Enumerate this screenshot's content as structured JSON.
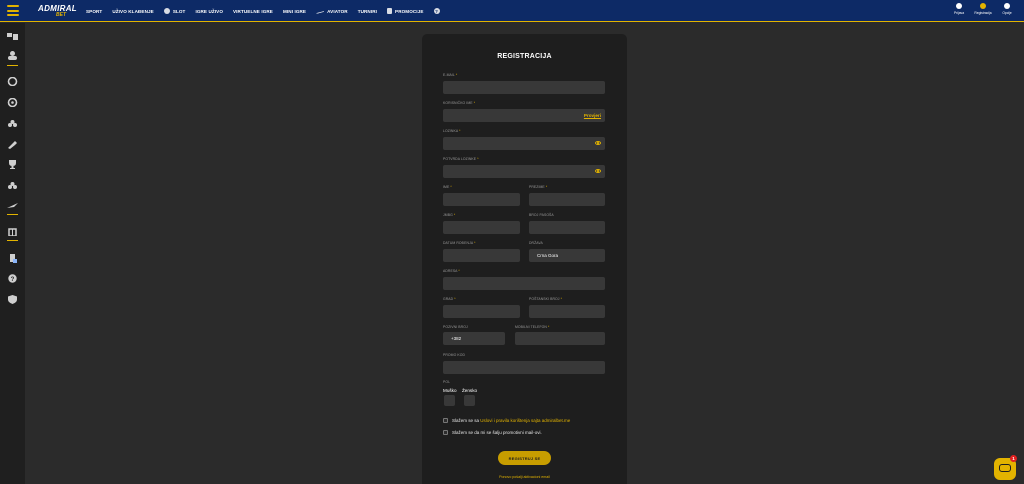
{
  "header": {
    "logo_text": "ADMIRAL",
    "logo_sub": "BET",
    "nav": [
      {
        "label": "SPORT",
        "icon": "none"
      },
      {
        "label": "UŽIVO KLAĐENJE",
        "icon": "none"
      },
      {
        "label": "SLOT",
        "icon": "chip-icon"
      },
      {
        "label": "IGRE UŽIVO",
        "icon": "none"
      },
      {
        "label": "VIRTUELNE IGRE",
        "icon": "none"
      },
      {
        "label": "MINI IGRE",
        "icon": "none"
      },
      {
        "label": "AVIATOR",
        "icon": "plane-icon"
      },
      {
        "label": "TURNIRI",
        "icon": "none"
      },
      {
        "label": "PROMOCIJE",
        "icon": "gift-icon"
      }
    ],
    "help_glyph": "?",
    "right": [
      {
        "label": "Prijava"
      },
      {
        "label": "Registracija"
      },
      {
        "label": "Opcije"
      }
    ]
  },
  "form": {
    "title": "REGISTRACIJA",
    "fields": {
      "email": {
        "label": "E-MAIL",
        "value": ""
      },
      "username": {
        "label": "KORISNIČKO IME",
        "value": "",
        "check": "Provjeri"
      },
      "password": {
        "label": "LOZINKA",
        "value": ""
      },
      "password_confirm": {
        "label": "POTVRDA LOZINKE",
        "value": ""
      },
      "first_name": {
        "label": "IME",
        "value": ""
      },
      "last_name": {
        "label": "PREZIME",
        "value": ""
      },
      "jmbg": {
        "label": "JMBG",
        "value": ""
      },
      "passport": {
        "label": "BROJ PASOŠA",
        "value": ""
      },
      "birth_date": {
        "label": "DATUM ROĐENJA",
        "value": ""
      },
      "country": {
        "label": "DRŽAVA",
        "value": "Crna Gora"
      },
      "address": {
        "label": "ADRESA",
        "value": ""
      },
      "city": {
        "label": "GRAD",
        "value": ""
      },
      "postal": {
        "label": "POŠTANSKI BROJ",
        "value": ""
      },
      "dial_code": {
        "label": "POZIVNI BROJ",
        "value": "+382"
      },
      "phone": {
        "label": "MOBILNI TELEFON",
        "value": ""
      },
      "promo": {
        "label": "PROMO KOD",
        "value": ""
      }
    },
    "required_mark": "*",
    "gender": {
      "label": "POL",
      "male": "Muško",
      "female": "Žensko"
    },
    "checkbox_terms_prefix": "Slažem se sa ",
    "checkbox_terms_link": "Uslovi i pravila korištenja sajta admiralbet.me",
    "checkbox_promo": "Slažem se da mi se šalju promotivni mail-ovi.",
    "submit": "REGISTRUJ SE",
    "resend": "Ponovo pošalji aktivacioni email"
  },
  "chat": {
    "badge": "1"
  },
  "colors": {
    "accent": "#e2b300",
    "header": "#0d2a66",
    "panel": "#1e1e1e",
    "input": "#383838"
  }
}
